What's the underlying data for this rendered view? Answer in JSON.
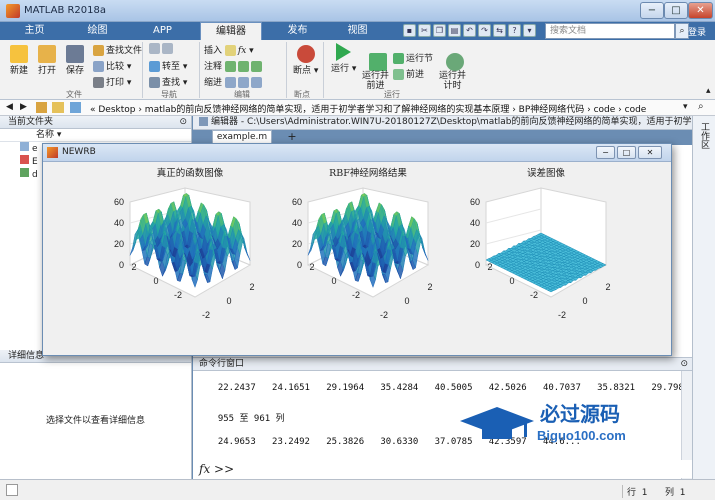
{
  "app": {
    "title": "MATLAB R2018a"
  },
  "window_controls": {
    "minimize": "−",
    "maximize": "□",
    "close": "✕"
  },
  "tabs": [
    {
      "label": "主页"
    },
    {
      "label": "绘图"
    },
    {
      "label": "APP"
    },
    {
      "label": "编辑器"
    },
    {
      "label": "发布"
    },
    {
      "label": "视图"
    }
  ],
  "search": {
    "placeholder": "搜索文档"
  },
  "ribbon": {
    "file": {
      "group": "文件",
      "new": "新建",
      "open": "打开",
      "save": "保存",
      "find_files": "查找文件",
      "compare": "比较",
      "print": "打印"
    },
    "nav": {
      "group": "导航",
      "goto": "转至",
      "find": "查找"
    },
    "edit": {
      "group": "编辑",
      "insert": "插入",
      "comment": "注释",
      "indent": "缩进",
      "fx": "fx"
    },
    "breakpoints": {
      "group": "断点",
      "label": "断点"
    },
    "run": {
      "group": "运行",
      "run": "运行",
      "run_advance": "运行并\n前进",
      "run_section": "运行节",
      "advance": "前进",
      "run_time": "运行并\n计时"
    }
  },
  "pathbar": {
    "path": "« Desktop › matlab的前向反馈神经网络的简单实现，适用于初学者学习和了解神经网络的实现基本原理 › BP神经网络代码 › code › code"
  },
  "left_panel": {
    "current_folder": "当前文件夹",
    "column_name": "名称 ▾",
    "files": [
      "e",
      "E",
      "d"
    ],
    "details_header": "详细信息",
    "details_hint": "选择文件以查看详细信息"
  },
  "editor": {
    "header": "编辑器 - C:\\Users\\Administrator.WIN7U-20180127Z\\Desktop\\matlab的前向反馈神经网络的简单实现，适用于初学...",
    "file_tab": "example.m",
    "add_tab": "+"
  },
  "figure": {
    "title": "NEWRB",
    "plots": [
      {
        "title": "真正的函数图像"
      },
      {
        "title": "RBF神经网络结果"
      },
      {
        "title": "误差图像"
      }
    ],
    "z_ticks": [
      "60",
      "40",
      "20",
      "0"
    ],
    "xy_ticks": [
      "2",
      "0",
      "-2"
    ]
  },
  "command_window": {
    "header": "命令行窗口",
    "lines": [
      "  22.2437   24.1651   29.1964   35.4284   40.5005   42.5026   40.7037   35.8321   29.7980",
      "",
      "  955 至 961 列",
      "",
      "  24.9653   23.2492   25.3826   30.6330   37.0785   42.3597   44.6..."
    ],
    "prompt": "fx >>"
  },
  "status": {
    "row_label": "行",
    "row_value": "1",
    "col_label": "列",
    "col_value": "1"
  },
  "right_strip": {
    "label": "工作区"
  },
  "watermark": {
    "text": "必过源码",
    "url": "Biguo100.com"
  },
  "colors": {
    "accent": "#3c6ea8",
    "surface_low": "#1a237e",
    "surface_mid": "#21a6a3",
    "surface_high": "#fde725"
  }
}
